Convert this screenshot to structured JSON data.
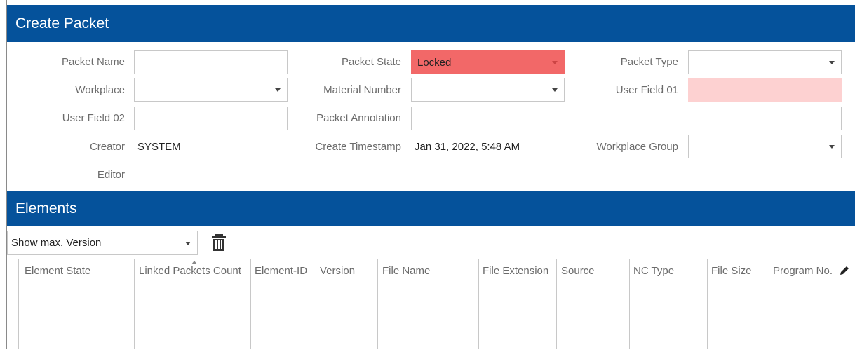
{
  "create_packet": {
    "title": "Create Packet",
    "packet_name_label": "Packet Name",
    "packet_name_value": "",
    "workplace_label": "Workplace",
    "workplace_value": "",
    "user_field_02_label": "User Field 02",
    "user_field_02_value": "",
    "creator_label": "Creator",
    "creator_value": "SYSTEM",
    "editor_label": "Editor",
    "editor_value": "",
    "packet_state_label": "Packet State",
    "packet_state_value": "Locked",
    "material_number_label": "Material Number",
    "material_number_value": "",
    "packet_annotation_label": "Packet Annotation",
    "packet_annotation_value": "",
    "create_timestamp_label": "Create Timestamp",
    "create_timestamp_value": "Jan 31, 2022, 5:48 AM",
    "packet_type_label": "Packet Type",
    "packet_type_value": "",
    "user_field_01_label": "User Field 01",
    "user_field_01_value": "",
    "workplace_group_label": "Workplace Group",
    "workplace_group_value": ""
  },
  "elements": {
    "title": "Elements",
    "version_filter": "Show max. Version",
    "delete_icon": "trash-icon",
    "columns": [
      "Element State",
      "Linked Packets Count",
      "Element-ID",
      "Version",
      "File Name",
      "File Extension",
      "Source",
      "NC Type",
      "File Size",
      "Program No."
    ],
    "rows": []
  },
  "colors": {
    "header_bg": "#05529b",
    "locked_state": "#f26868",
    "required_field": "#fdd1d1"
  }
}
